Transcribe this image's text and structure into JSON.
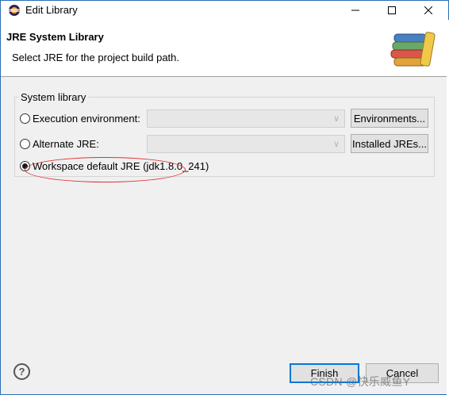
{
  "window": {
    "title": "Edit Library",
    "accent_color": "#2b6fb6"
  },
  "header": {
    "title": "JRE System Library",
    "description": "Select JRE for the project build path."
  },
  "group": {
    "label": "System library",
    "options": [
      {
        "label": "Execution environment:",
        "selected": false,
        "combo_value": "",
        "button_label": "Environments..."
      },
      {
        "label": "Alternate JRE:",
        "selected": false,
        "combo_value": "",
        "button_label": "Installed JREs..."
      },
      {
        "label": "Workspace default JRE (jdk1.8.0_241)",
        "selected": true
      }
    ]
  },
  "footer": {
    "help_glyph": "?",
    "finish_label": "Finish",
    "cancel_label": "Cancel"
  },
  "watermark": "CSDN @快乐威鱼Y",
  "annotation_color": "#e03030"
}
